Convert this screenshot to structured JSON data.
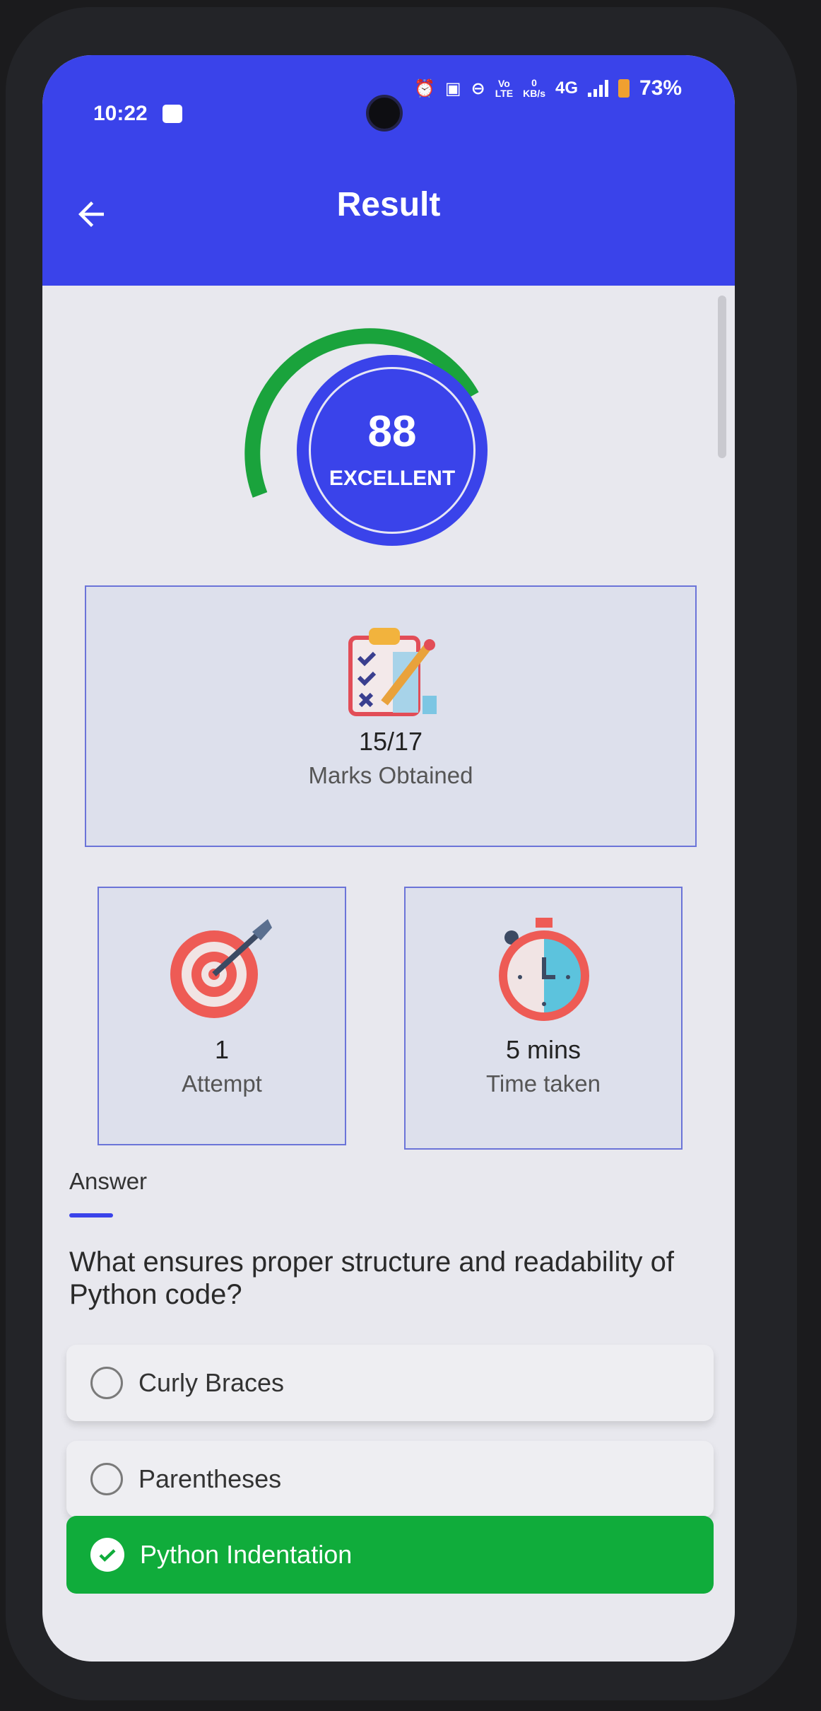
{
  "status_bar": {
    "time": "10:22",
    "lte_label": "Vo\nLTE",
    "kbs_value": "0",
    "kbs_unit": "KB/s",
    "network": "4G",
    "battery": "73%"
  },
  "header": {
    "title": "Result"
  },
  "score": {
    "value": "88",
    "label": "EXCELLENT",
    "gauge_color": "#1aa33c",
    "circle_color": "#3a43ea"
  },
  "marks": {
    "value": "15/17",
    "label": "Marks Obtained"
  },
  "attempt": {
    "value": "1",
    "label": "Attempt"
  },
  "time_taken": {
    "value": "5 mins",
    "label": "Time taken"
  },
  "answer_tab": "Answer",
  "question": "What ensures proper structure and readability of Python code?",
  "options": [
    {
      "text": "Curly Braces",
      "correct": false
    },
    {
      "text": "Parentheses",
      "correct": false
    },
    {
      "text": "Python Indentation",
      "correct": true
    }
  ],
  "colors": {
    "accent": "#3a43ea",
    "correct": "#10ac3b"
  },
  "icons": {
    "back": "back-arrow-icon",
    "marks": "clipboard-checklist-icon",
    "attempt": "target-arrow-icon",
    "time": "stopwatch-icon",
    "correct": "checkmark-icon"
  }
}
